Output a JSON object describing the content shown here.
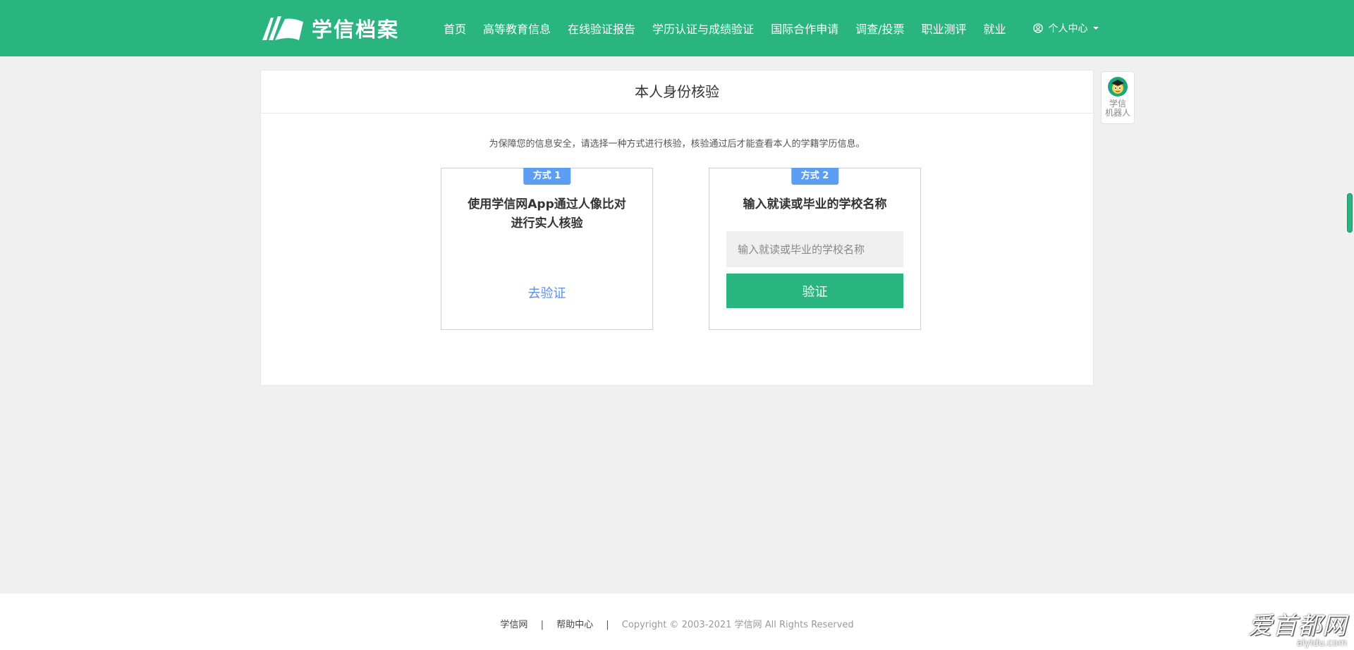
{
  "header": {
    "logo_text": "学信档案",
    "nav": [
      {
        "label": "首页"
      },
      {
        "label": "高等教育信息"
      },
      {
        "label": "在线验证报告"
      },
      {
        "label": "学历认证与成绩验证"
      },
      {
        "label": "国际合作申请"
      },
      {
        "label": "调查/投票"
      },
      {
        "label": "职业测评"
      },
      {
        "label": "就业"
      }
    ],
    "user_center": "个人中心"
  },
  "card": {
    "title": "本人身份核验",
    "description": "为保障您的信息安全，请选择一种方式进行核验，核验通过后才能查看本人的学籍学历信息。",
    "method1": {
      "badge": "方式 1",
      "heading_line1": "使用学信网App通过人像比对",
      "heading_line2": "进行实人核验",
      "link": "去验证"
    },
    "method2": {
      "badge": "方式 2",
      "heading": "输入就读或毕业的学校名称",
      "input_placeholder": "输入就读或毕业的学校名称",
      "input_value": "",
      "button": "验证"
    }
  },
  "robot": {
    "label_line1": "学信",
    "label_line2": "机器人"
  },
  "footer": {
    "link1": "学信网",
    "separator": "|",
    "link2": "帮助中心",
    "copyright": "Copyright © 2003-2021 学信网 All Rights Reserved"
  },
  "watermark": {
    "brand": "爱首都网",
    "url": "aiyidu.com"
  },
  "colors": {
    "brand_green": "#2ab580",
    "badge_blue": "#5c9ef4",
    "link_blue": "#5c8fe6",
    "page_bg": "#f0f0f0"
  },
  "icons": {
    "logo": "book-pages-icon",
    "user": "user-circle-icon",
    "robot": "robot-avatar-icon"
  }
}
